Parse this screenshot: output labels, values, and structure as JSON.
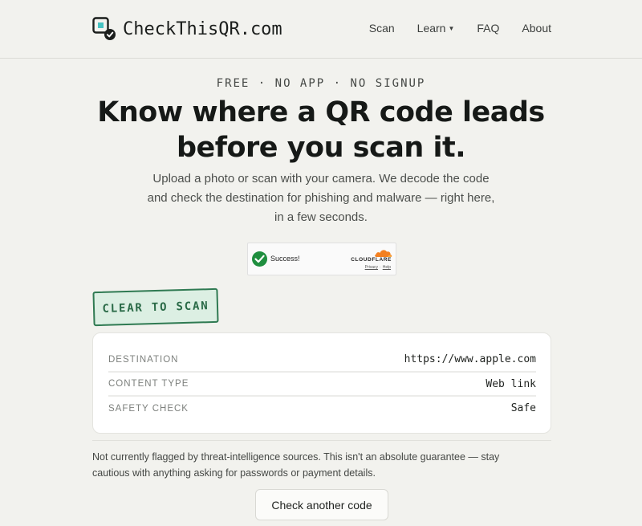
{
  "header": {
    "logo_text": "CheckThisQR.com",
    "nav": [
      {
        "label": "Scan"
      },
      {
        "label": "Learn",
        "has_caret": true
      },
      {
        "label": "FAQ"
      },
      {
        "label": "About"
      }
    ]
  },
  "hero": {
    "kicker": "FREE · NO APP · NO SIGNUP",
    "headline_line1": "Know where a QR code leads",
    "headline_line2": "before you scan it.",
    "lede": "Upload a photo or scan with your camera. We decode the code and check the destination for phishing and malware — right here, in a few seconds."
  },
  "turnstile": {
    "status": "Success!",
    "brand": "CLOUDFLARE",
    "link_privacy": "Privacy",
    "link_sep": "·",
    "link_help": "Help"
  },
  "result": {
    "stamp": "CLEAR TO SCAN",
    "rows": [
      {
        "label": "DESTINATION",
        "value": "https://www.apple.com"
      },
      {
        "label": "CONTENT TYPE",
        "value": "Web link"
      },
      {
        "label": "SAFETY CHECK",
        "value": "Safe"
      }
    ],
    "note": "Not currently flagged by threat-intelligence sources. This isn't an absolute guarantee — stay cautious with anything asking for passwords or payment details.",
    "again_button": "Check another code"
  },
  "colors": {
    "background": "#f2f2ee",
    "stamp_green": "#2f7a52",
    "success_green": "#1e8e3e",
    "cloudflare_orange": "#f38020"
  },
  "icons": {
    "logo": "qr-check-icon",
    "turnstile_status": "check-circle-icon",
    "turnstile_brand": "cloud-icon"
  }
}
